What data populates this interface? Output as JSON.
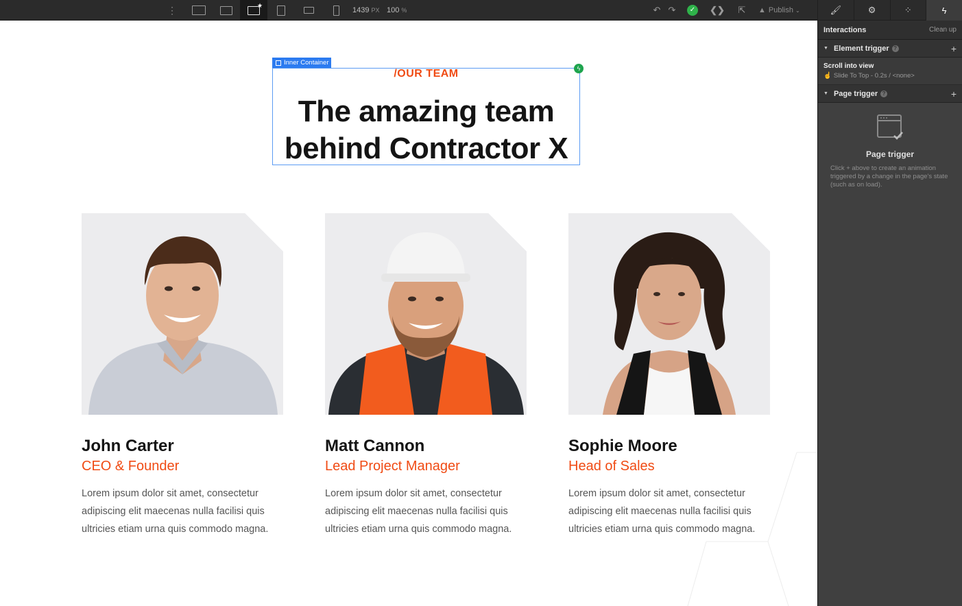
{
  "toolbar": {
    "menu_icon": "more-vertical-icon",
    "devices": [
      "desktop-large-icon",
      "desktop-icon",
      "desktop-base-icon",
      "tablet-icon",
      "mobile-landscape-icon",
      "mobile-portrait-icon"
    ],
    "width_value": "1439",
    "width_unit": "PX",
    "zoom_value": "100",
    "zoom_unit": "%",
    "publish_label": "Publish"
  },
  "panel": {
    "tabs": [
      "style-brush-icon",
      "settings-gear-icon",
      "interactions-drops-icon",
      "lightning-icon"
    ],
    "title": "Interactions",
    "clean_label": "Clean up",
    "element_trigger_label": "Element trigger",
    "trigger_name": "Scroll into view",
    "trigger_detail": "Slide To Top - 0.2s / <none>",
    "page_trigger_label": "Page trigger",
    "empty_title": "Page trigger",
    "empty_desc": "Click + above to create an animation triggered by a change in the page's state (such as on load)."
  },
  "canvas": {
    "selection_label": "Inner Container",
    "eyebrow": "/OUR TEAM",
    "heading_line1": "The amazing team",
    "heading_line2": "behind Contractor X",
    "team": [
      {
        "name": "John Carter",
        "role": "CEO & Founder",
        "bio": "Lorem ipsum dolor sit amet, consectetur adipiscing elit maecenas nulla facilisi quis ultricies etiam urna quis commodo magna."
      },
      {
        "name": "Matt Cannon",
        "role": "Lead Project Manager",
        "bio": "Lorem ipsum dolor sit amet, consectetur adipiscing elit maecenas nulla facilisi quis ultricies etiam urna quis commodo magna."
      },
      {
        "name": "Sophie Moore",
        "role": "Head of Sales",
        "bio": "Lorem ipsum dolor sit amet, consectetur adipiscing elit maecenas nulla facilisi quis ultricies etiam urna quis commodo magna."
      }
    ]
  },
  "colors": {
    "accent": "#f04b14",
    "selection": "#2c7bf0",
    "status_ok": "#2fb24a"
  }
}
